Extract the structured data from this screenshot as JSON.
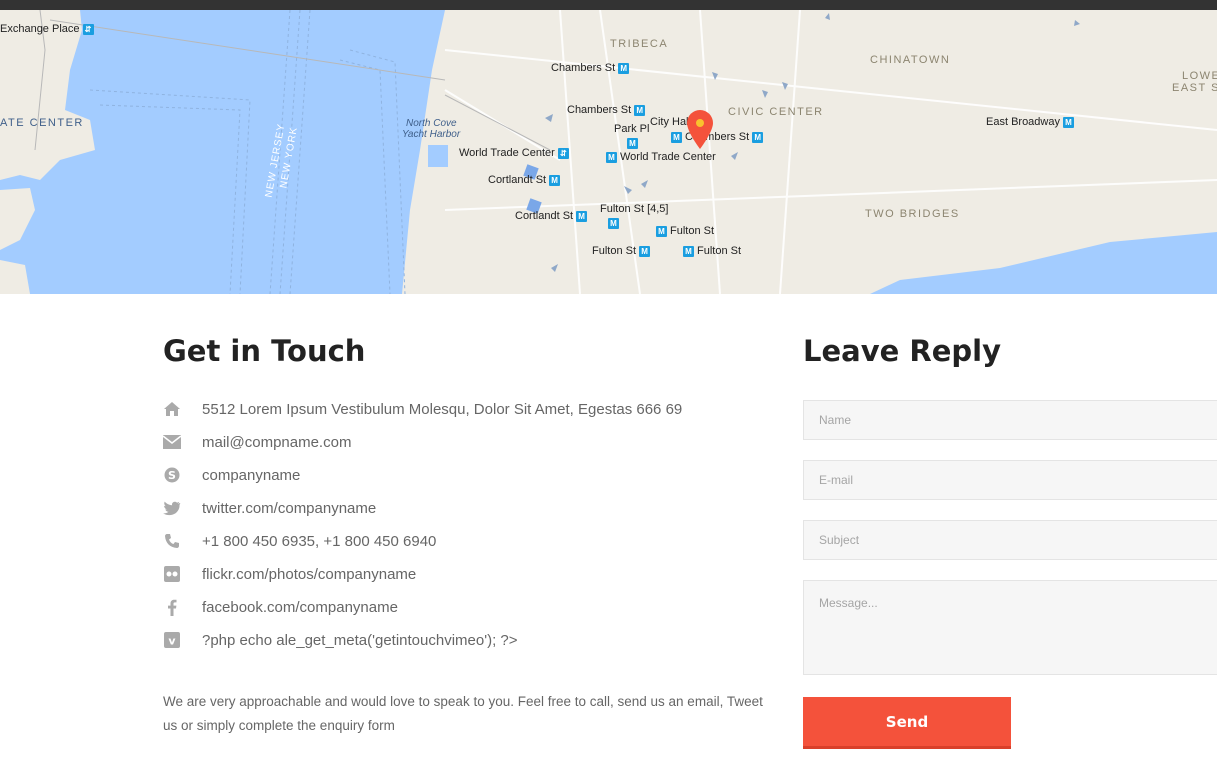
{
  "map": {
    "districts": [
      "TRIBECA",
      "CHINATOWN",
      "CIVIC CENTER",
      "TWO BRIDGES",
      "LOWE",
      "EAST S",
      "ATE CENTER"
    ],
    "labels": {
      "exchange_place": "Exchange Place",
      "chambers_st_1": "Chambers St",
      "chambers_st_2": "Chambers St",
      "chambers_st_3": "Chambers St",
      "city_hall": "City Hall",
      "park_pl": "Park Pl",
      "world_trade_center_1": "World Trade Center",
      "world_trade_center_2": "World Trade Center",
      "cortlandt_st_1": "Cortlandt St",
      "cortlandt_st_2": "Cortlandt St",
      "fulton_st_45": "Fulton St [4,5]",
      "fulton_st_1": "Fulton St",
      "fulton_st_2": "Fulton St",
      "fulton_st_3": "Fulton St",
      "east_broadway": "East Broadway",
      "north_cove": "North Cove",
      "yacht_harbor": "Yacht Harbor",
      "new_jersey": "NEW JERSEY",
      "new_york": "NEW YORK"
    },
    "marker_color": "#f4523b",
    "metro_symbol": "M"
  },
  "contact": {
    "title": "Get in Touch",
    "items": [
      {
        "icon": "home-icon",
        "text": "5512 Lorem Ipsum Vestibulum Molesqu, Dolor Sit Amet, Egestas 666 69"
      },
      {
        "icon": "envelope-icon",
        "text": "mail@compname.com"
      },
      {
        "icon": "skype-icon",
        "text": "companyname"
      },
      {
        "icon": "twitter-icon",
        "text": "twitter.com/companyname"
      },
      {
        "icon": "phone-icon",
        "text": "+1 800 450 6935, +1 800 450 6940"
      },
      {
        "icon": "flickr-icon",
        "text": "flickr.com/photos/companyname"
      },
      {
        "icon": "facebook-icon",
        "text": "facebook.com/companyname"
      },
      {
        "icon": "vimeo-icon",
        "text": "?php echo ale_get_meta('getintouchvimeo'); ?>"
      }
    ],
    "intro": "We are very approachable and would love to speak to you. Feel free to call, send us an email, Tweet us or simply complete the enquiry form"
  },
  "reply": {
    "title": "Leave Reply",
    "name_placeholder": "Name",
    "email_placeholder": "E-mail",
    "subject_placeholder": "Subject",
    "message_placeholder": "Message...",
    "send_label": "Send"
  },
  "colors": {
    "accent": "#f4523b",
    "water": "#a3ccff",
    "land": "#efece4",
    "metro": "#1a9ee0"
  }
}
